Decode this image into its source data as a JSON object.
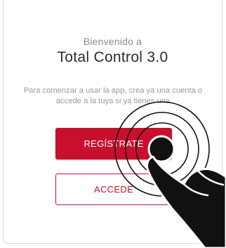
{
  "welcome": {
    "greeting": "Bienvenido a",
    "app_title": "Total Control 3.0",
    "intro_text": "Para comenzar a usar la app, crea ya una cuenta o accede a la tuya si ya tienes una"
  },
  "actions": {
    "register_label": "REGÍSTRATE",
    "login_label": "ACCEDE"
  },
  "colors": {
    "accent": "#c8102e",
    "hand": "#111111"
  },
  "icons": {
    "tap_gesture": "hand-tap-icon"
  }
}
